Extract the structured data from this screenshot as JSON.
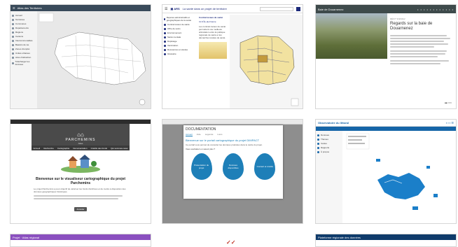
{
  "cards": [
    {
      "id": "c1",
      "header_title": "Atlas des Territoires",
      "sidebar_items": [
        "Accueil",
        "Territoires",
        "Communes",
        "Départements",
        "Régions",
        "Cantons",
        "Intercommunalités",
        "Bassins de vie",
        "Zones d'emploi",
        "Unités urbaines",
        "Aires d'attraction",
        "Télécharger les données"
      ],
      "colors": {
        "header": "#394a5a",
        "sidebar": "#f4f4f4",
        "map": "#e9e9e9"
      }
    },
    {
      "id": "c2",
      "header_title": "La santé dans un projet de territoire",
      "search_placeholder": "Rechercher",
      "sidebar_items": [
        "Repères administratifs et géographiques de la santé",
        "Contrat locaux de santé",
        "Offre de soins",
        "Environnement",
        "Santé mentale",
        "Dépistage",
        "Vaccination",
        "Ressources et études",
        "Glossaire"
      ],
      "panel_title": "Contrat locaux de santé",
      "panel_subtitle": "CLS Île-de-France",
      "panel_text": "Les contrats locaux de santé permettent une meilleure articulation entre la politique régionale de santé et les démarches locales de santé.",
      "colors": {
        "header": "#ffffff",
        "accent": "#1c2a7a",
        "map": "#f2e2a0"
      }
    },
    {
      "id": "c3",
      "header_title": "Baie de Douarnenez",
      "kicker": "RÉCIT D'ESSAI",
      "title": "Regards sur la baie de Douarnenez",
      "colors": {
        "header": "#3e4a4b",
        "photo": "#6a7a4a"
      }
    },
    {
      "id": "c4",
      "brand": "PARCHEMINS",
      "brand_sub": "Atlas",
      "nav_items": [
        "Accueil",
        "Recherche",
        "Cartographie",
        "Documentation",
        "Crédits des fonds",
        "Qui sommes-nous"
      ],
      "welcome_title": "Bienvenue sur le visualiseur cartographique du projet Parchemins",
      "welcome_text": "Le projet Parchemins a pour objectif de valoriser les fonds d'archives et de mettre à disposition des données géographiques historiques.",
      "cta_label": "Accéder",
      "colors": {
        "header": "#3a3a3a",
        "banner": "#4a4a4a"
      }
    },
    {
      "id": "c5",
      "modal_title": "DOCUMENTATION",
      "tabs": [
        "Accueil",
        "Aide",
        "Légende",
        "Liens"
      ],
      "modal_heading": "Bienvenue sur le portail cartographique du projet DIMPACT",
      "modal_text": "Ce portail vous permet de consulter les données produites dans le cadre du projet.",
      "modal_question": "Vous souhaitez en savoir plus ?",
      "drops": [
        "Présentation du projet",
        "Données disponibles",
        "Contact et crédits"
      ],
      "colors": {
        "drop": "#1e7fb8",
        "map": "#8e8e8e"
      }
    },
    {
      "id": "c6",
      "header_title": "Observatoire du littoral",
      "subheader": "Suivi de l'artificialisation des sols",
      "sidebar_items": [
        "Données",
        "Thèmes",
        "Cartes",
        "Rapports",
        "À propos"
      ],
      "colors": {
        "header": "#1565a8",
        "accent": "#1b7fc9",
        "map": "#ffffff"
      }
    },
    {
      "id": "c7",
      "header_title": "Projet · Atlas régional",
      "colors": {
        "header": "#8a4fbf"
      }
    },
    {
      "id": "c8",
      "header_title": "",
      "colors": {
        "header": "#ffffff"
      }
    },
    {
      "id": "c9",
      "header_title": "Plateforme régionale des données",
      "colors": {
        "header": "#0f3b6b"
      }
    }
  ]
}
